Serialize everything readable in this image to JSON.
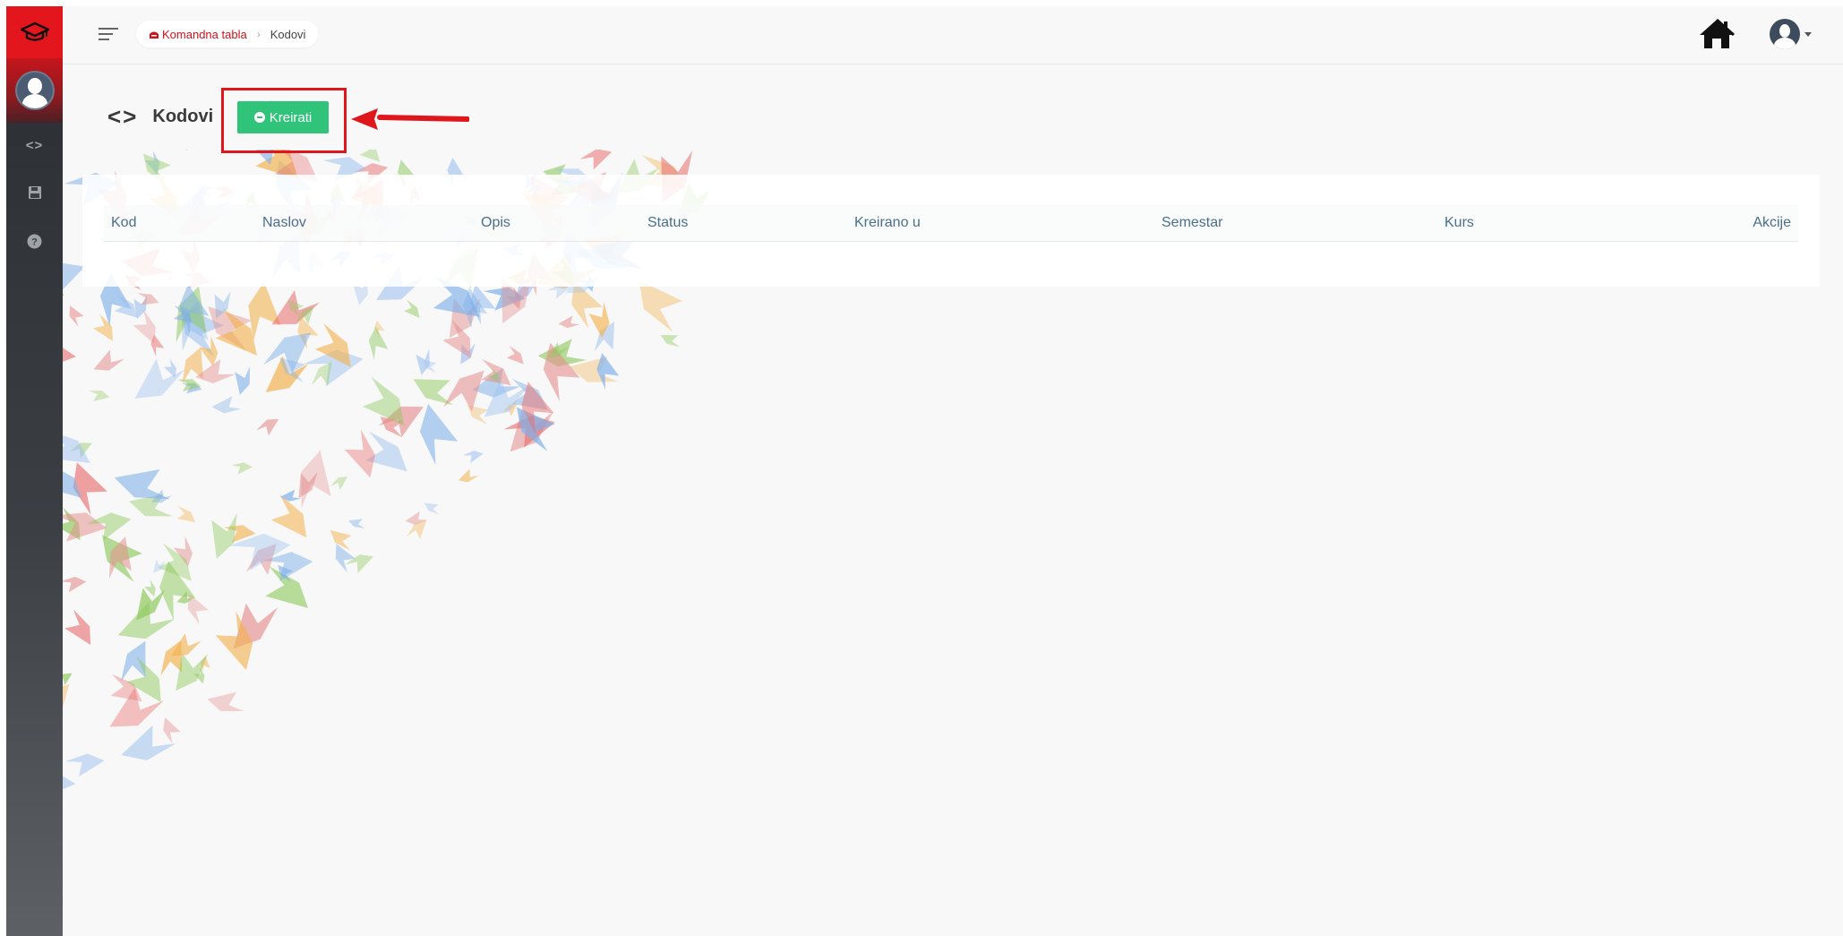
{
  "breadcrumb": {
    "home_label": "Komandna tabla",
    "current_label": "Kodovi"
  },
  "page": {
    "title": "Kodovi",
    "create_label": "Kreirati"
  },
  "table": {
    "columns": [
      "Kod",
      "Naslov",
      "Opis",
      "Status",
      "Kreirano u",
      "Semestar",
      "Kurs",
      "Akcije"
    ]
  },
  "sidebar": {
    "items": [
      {
        "icon": "code-icon"
      },
      {
        "icon": "save-icon"
      },
      {
        "icon": "help-icon"
      }
    ]
  },
  "colors": {
    "brand_red": "#e3151d",
    "create_green": "#2fc47a",
    "header_text": "#4a6f8a"
  }
}
